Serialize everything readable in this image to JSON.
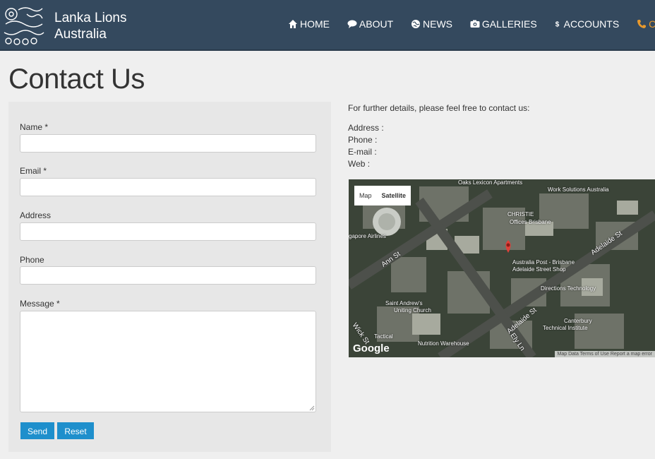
{
  "brand": {
    "line1": "Lanka Lions",
    "line2": "Australia"
  },
  "nav": [
    {
      "label": "HOME",
      "icon": "home-icon"
    },
    {
      "label": "ABOUT",
      "icon": "chat-icon"
    },
    {
      "label": "NEWS",
      "icon": "globe-icon"
    },
    {
      "label": "GALLERIES",
      "icon": "camera-icon"
    },
    {
      "label": "ACCOUNTS",
      "icon": "dollar-icon"
    },
    {
      "label": "CONTA",
      "icon": "phone-icon",
      "active": true
    }
  ],
  "page_title": "Contact Us",
  "form": {
    "name_label": "Name *",
    "email_label": "Email *",
    "address_label": "Address",
    "phone_label": "Phone",
    "message_label": "Message *",
    "send_label": "Send",
    "reset_label": "Reset"
  },
  "info": {
    "heading": "For further details, please feel free to contact us:",
    "address": "Address :",
    "phone": "Phone :",
    "email": "E-mail :",
    "web": "Web :"
  },
  "map": {
    "toggle_map": "Map",
    "toggle_satellite": "Satellite",
    "google": "Google",
    "footer": "Map Data  Terms of Use  Report a map error",
    "labels": {
      "oaks": "Oaks Lexicon Apartments",
      "work": "Work Solutions Australia",
      "christie": "CHRISTIE",
      "christie2": "Offices Brisbane",
      "singapore": "gapore Airlines",
      "aust_post": "Australia Post - Brisbane",
      "aust_post2": "Adelaide Street Shop",
      "directions": "Directions Technology",
      "st_andrew": "Saint Andrew's",
      "st_andrew2": "Uniting Church",
      "canterbury": "Canterbury",
      "canterbury2": "Technical Institute",
      "nutrition": "Nutrition Warehouse",
      "tactical": "Tactical",
      "ann_st": "Ann St",
      "adelaide_st": "Adelaide St",
      "adelaide_st2": "Adelaide St",
      "elizabeth": "Ely Ln",
      "wickham": "Wick St"
    }
  },
  "colors": {
    "navbar": "#34495e",
    "accent": "#e8992c",
    "button": "#1e8fcc"
  }
}
